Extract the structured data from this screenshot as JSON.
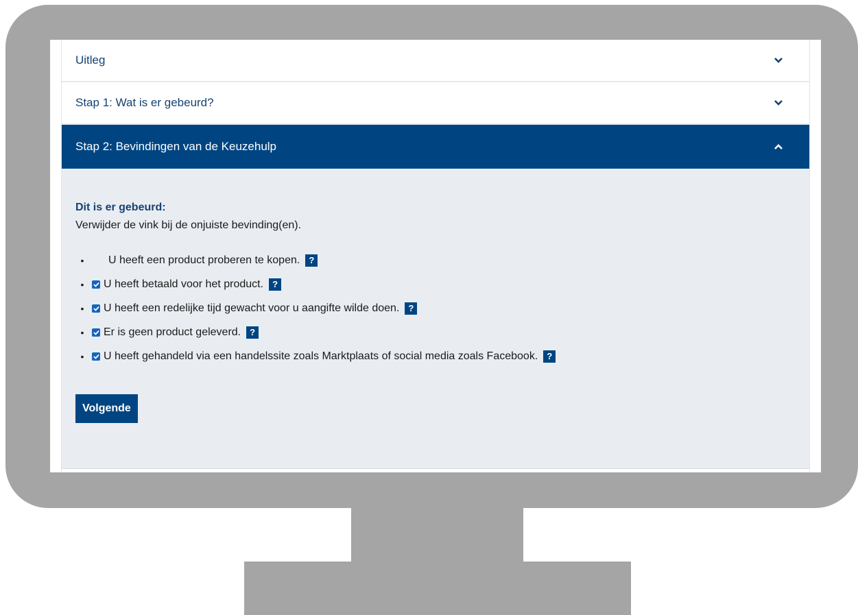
{
  "accordion": {
    "sections": [
      {
        "title": "Uitleg",
        "expanded": false
      },
      {
        "title": "Stap 1: Wat is er gebeurd?",
        "expanded": false
      },
      {
        "title": "Stap 2: Bevindingen van de Keuzehulp",
        "expanded": true
      }
    ]
  },
  "step2": {
    "heading": "Dit is er gebeurd:",
    "instruction": "Verwijder de vink bij de onjuiste bevinding(en).",
    "findings": [
      {
        "text": "U heeft een product proberen te kopen.",
        "checked": false
      },
      {
        "text": "U heeft betaald voor het product.",
        "checked": true
      },
      {
        "text": "U heeft een redelijke tijd gewacht voor u aangifte wilde doen.",
        "checked": true
      },
      {
        "text": "Er is geen product geleverd.",
        "checked": true
      },
      {
        "text": "U heeft gehandeld via een handelssite zoals Marktplaats of social media zoals Facebook.",
        "checked": true
      }
    ],
    "help_symbol": "?",
    "next_label": "Volgende"
  },
  "colors": {
    "primary": "#004582",
    "link": "#154273",
    "panel": "#e9edf2",
    "checkbox": "#1565c0",
    "frame": "#a5a5a5"
  },
  "icons": {
    "collapsed": "chevron-down-icon",
    "expanded": "chevron-up-icon",
    "help": "help-icon",
    "check": "checkbox-checked-icon"
  }
}
